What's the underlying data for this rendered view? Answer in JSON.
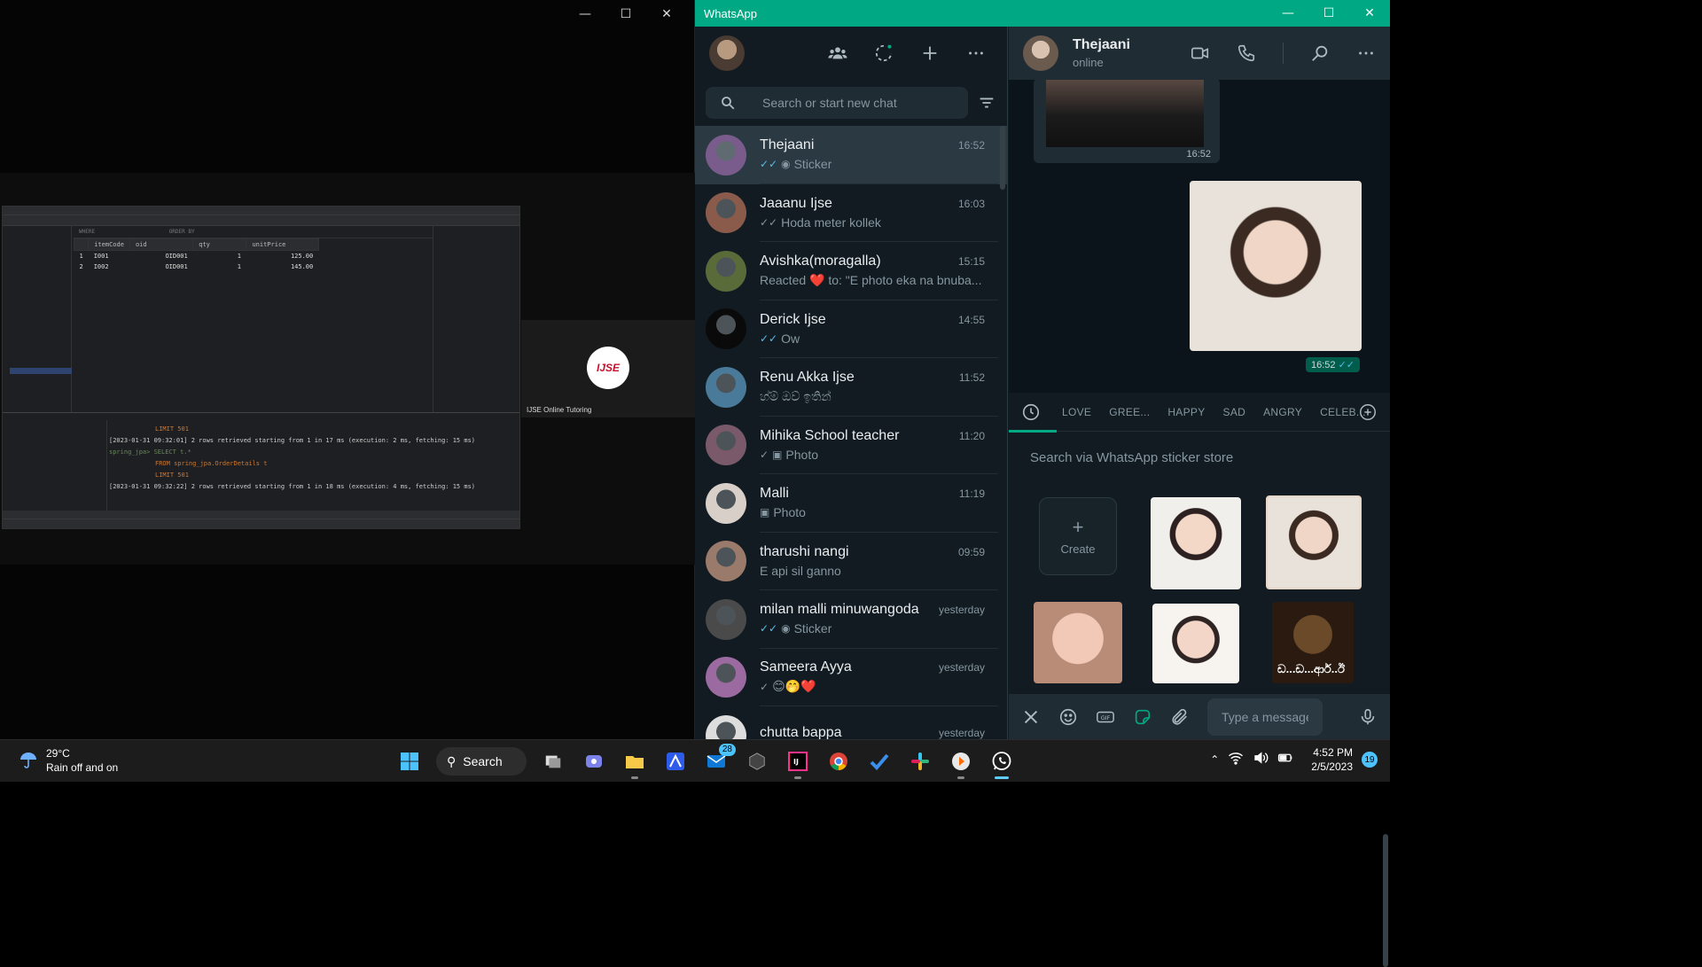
{
  "left_window": {
    "ide": {
      "filter_where": "WHERE",
      "filter_order": "ORDER BY",
      "columns": [
        "itemCode",
        "oid",
        "qty",
        "unitPrice"
      ],
      "rows": [
        [
          "1",
          "I001",
          "OID001",
          "1",
          "125.00"
        ],
        [
          "2",
          "I002",
          "OID001",
          "1",
          "145.00"
        ]
      ],
      "console_lines": [
        "LIMIT 501",
        "[2023-01-31 09:32:01] 2 rows retrieved starting from 1 in 17 ms (execution: 2 ms, fetching: 15 ms)",
        "spring_jpa> SELECT t.*",
        "FROM spring_jpa.OrderDetails t",
        "LIMIT 501",
        "[2023-01-31 09:32:22] 2 rows retrieved starting from 1 in 18 ms (execution: 4 ms, fetching: 15 ms)"
      ]
    },
    "tile_name": "IJSE Online Tutoring",
    "logo_text": "IJSE"
  },
  "whatsapp": {
    "title": "WhatsApp",
    "search_placeholder": "Search or start new chat",
    "chats": [
      {
        "name": "Thejaani",
        "time": "16:52",
        "preview": "Sticker",
        "tick": "double-blue",
        "icon": "sticker-icon",
        "color": "#7a5c8c"
      },
      {
        "name": "Jaaanu Ijse",
        "time": "16:03",
        "preview": "Hoda meter kollek",
        "tick": "double-grey",
        "icon": "",
        "color": "#8a5a4a"
      },
      {
        "name": "Avishka(moragalla)",
        "time": "15:15",
        "preview": "Reacted ❤️ to: \"E photo eka na bnuba...",
        "tick": "",
        "icon": "",
        "color": "#5a6b3a"
      },
      {
        "name": "Derick Ijse",
        "time": "14:55",
        "preview": "Ow",
        "tick": "double-blue",
        "icon": "",
        "color": "#0a0a0a"
      },
      {
        "name": "Renu Akka Ijse",
        "time": "11:52",
        "preview": "හ්ම් ඔව් ඉතින්",
        "tick": "",
        "icon": "",
        "color": "#4a7a9a"
      },
      {
        "name": "Mihika School teacher",
        "time": "11:20",
        "preview": "Photo",
        "tick": "single",
        "icon": "camera-icon",
        "color": "#7a5a6a"
      },
      {
        "name": "Malli",
        "time": "11:19",
        "preview": "Photo",
        "tick": "",
        "icon": "camera-icon",
        "color": "#d8d0c8"
      },
      {
        "name": "tharushi nangi",
        "time": "09:59",
        "preview": "E api sil ganno",
        "tick": "",
        "icon": "",
        "color": "#9a7a6a"
      },
      {
        "name": "milan malli minuwangoda",
        "time": "yesterday",
        "preview": "Sticker",
        "tick": "double-blue",
        "icon": "sticker-icon",
        "color": "#4a4a4a"
      },
      {
        "name": "Sameera Ayya",
        "time": "yesterday",
        "preview": "😊🤭❤️",
        "tick": "single",
        "icon": "",
        "color": "#9a6aa0"
      },
      {
        "name": "chutta bappa",
        "time": "yesterday",
        "preview": "",
        "tick": "",
        "icon": "",
        "color": "#dddddd"
      }
    ],
    "conversation": {
      "contact_name": "Thejaani",
      "status": "online",
      "msg1_time": "16:52",
      "msg2_time": "16:52"
    },
    "sticker_panel": {
      "tabs": [
        "LOVE",
        "GREE...",
        "HAPPY",
        "SAD",
        "ANGRY",
        "CELEB..."
      ],
      "search_placeholder": "Search via WhatsApp sticker store",
      "create_label": "Create",
      "sticker5_text": "ඩ...ඩ...ආර්..ඊ"
    },
    "compose_placeholder": "Type a message"
  },
  "taskbar": {
    "temperature": "29°C",
    "weather_text": "Rain off and on",
    "search_label": "Search",
    "mail_badge": "28",
    "time": "4:52 PM",
    "date": "2/5/2023",
    "notification_count": "19"
  },
  "colors": {
    "whatsapp_green": "#00a884",
    "read_tick_blue": "#53bdeb"
  }
}
